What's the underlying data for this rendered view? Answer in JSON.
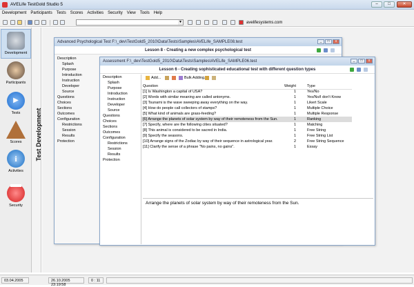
{
  "app": {
    "title": "AVELife TestGold Studio 5"
  },
  "menu": [
    "Development",
    "Participants",
    "Tests",
    "Scores",
    "Activities",
    "Security",
    "View",
    "Tools",
    "Help"
  ],
  "toolbar": {
    "link_text": "avelifesystems.com"
  },
  "sidebar": {
    "items": [
      {
        "label": "Development",
        "icon": "database-icon",
        "color": "#7f8c9b"
      },
      {
        "label": "Participants",
        "icon": "person-icon",
        "color": "#5d4a3c"
      },
      {
        "label": "Tests",
        "icon": "play-icon",
        "color": "#1f6fd0"
      },
      {
        "label": "Scores",
        "icon": "pyramid-icon",
        "color": "#b0703a"
      },
      {
        "label": "Activities",
        "icon": "info-icon",
        "color": "#1a6fc4"
      },
      {
        "label": "Security",
        "icon": "stop-icon",
        "color": "#d42020"
      }
    ]
  },
  "vertical_title": "Test Development",
  "back_window": {
    "title": "Advanced Psychological Test F:\\_dev\\TestGold5_2010\\Data\\Tests\\Samples\\AVELife_SAMPLE08.test",
    "lesson": "Lesson 8 - Creating a new complex psychological test",
    "tree": [
      "Description",
      "Splash",
      "Purpose",
      "Introduction",
      "Instruction",
      "Developer",
      "Source",
      "Questions",
      "Choices",
      "Sections",
      "Outcomes",
      "Configuration",
      "Restrictions",
      "Session",
      "Results",
      "Protection"
    ]
  },
  "front_window": {
    "title": "Assessment F:\\_dev\\TestGold5_2010\\Data\\Tests\\Samples\\AVELife_SAMPLE06.test",
    "lesson": "Lesson 6 - Creating sophisticated educational test with different question types",
    "tree": [
      "Description",
      "Splash",
      "Purpose",
      "Introduction",
      "Instruction",
      "Developer",
      "Source",
      "Questions",
      "Choices",
      "Sections",
      "Outcomes",
      "Configuration",
      "Restrictions",
      "Session",
      "Results",
      "Protection"
    ],
    "toolbar": {
      "add_label": "Add...",
      "bulk_label": "Bulk Adding..."
    },
    "columns": [
      "Question",
      "Weight",
      "Type"
    ],
    "rows": [
      {
        "q": "[1] Is Washington a capital of USA?",
        "w": "1",
        "t": "Yes/No"
      },
      {
        "q": "[2] Words with similar meaning are called antonyms.",
        "w": "1",
        "t": "Yes/No/I don't Know"
      },
      {
        "q": "[3] Tsunami is the wave sweeping away everything on the way.",
        "w": "1",
        "t": "Likert Scale"
      },
      {
        "q": "[4] How do people call collectors of stamps?",
        "w": "1",
        "t": "Multiple Choice"
      },
      {
        "q": "[5] What kind of animals are grass-feeding?",
        "w": "1",
        "t": "Multiple Response"
      },
      {
        "q": "[6] Arrange the planets of solar system by way of their remoteness from the Sun.",
        "w": "1",
        "t": "Ranking"
      },
      {
        "q": "[7] Specify, where are the following cities situated?",
        "w": "1",
        "t": "Matching"
      },
      {
        "q": "[8] This animal is considered to be sacred in India.",
        "w": "1",
        "t": "Free String"
      },
      {
        "q": "[9] Specify the seasons.",
        "w": "1",
        "t": "Free String List"
      },
      {
        "q": "[10] Arrange signs of the Zodiac by way of their sequence in astrological year.",
        "w": "2",
        "t": "Free String Sequence"
      },
      {
        "q": "[11] Clarify the sense of a phrase \"No pains, no gains\".",
        "w": "1",
        "t": "Essay"
      }
    ],
    "preview": "Arrange the planets of solar system by way of their remoteness from the Sun."
  },
  "status": {
    "date": "03.04.2005",
    "datetime": "26.10.2005 23:19:58",
    "timer": "0 : 11"
  }
}
